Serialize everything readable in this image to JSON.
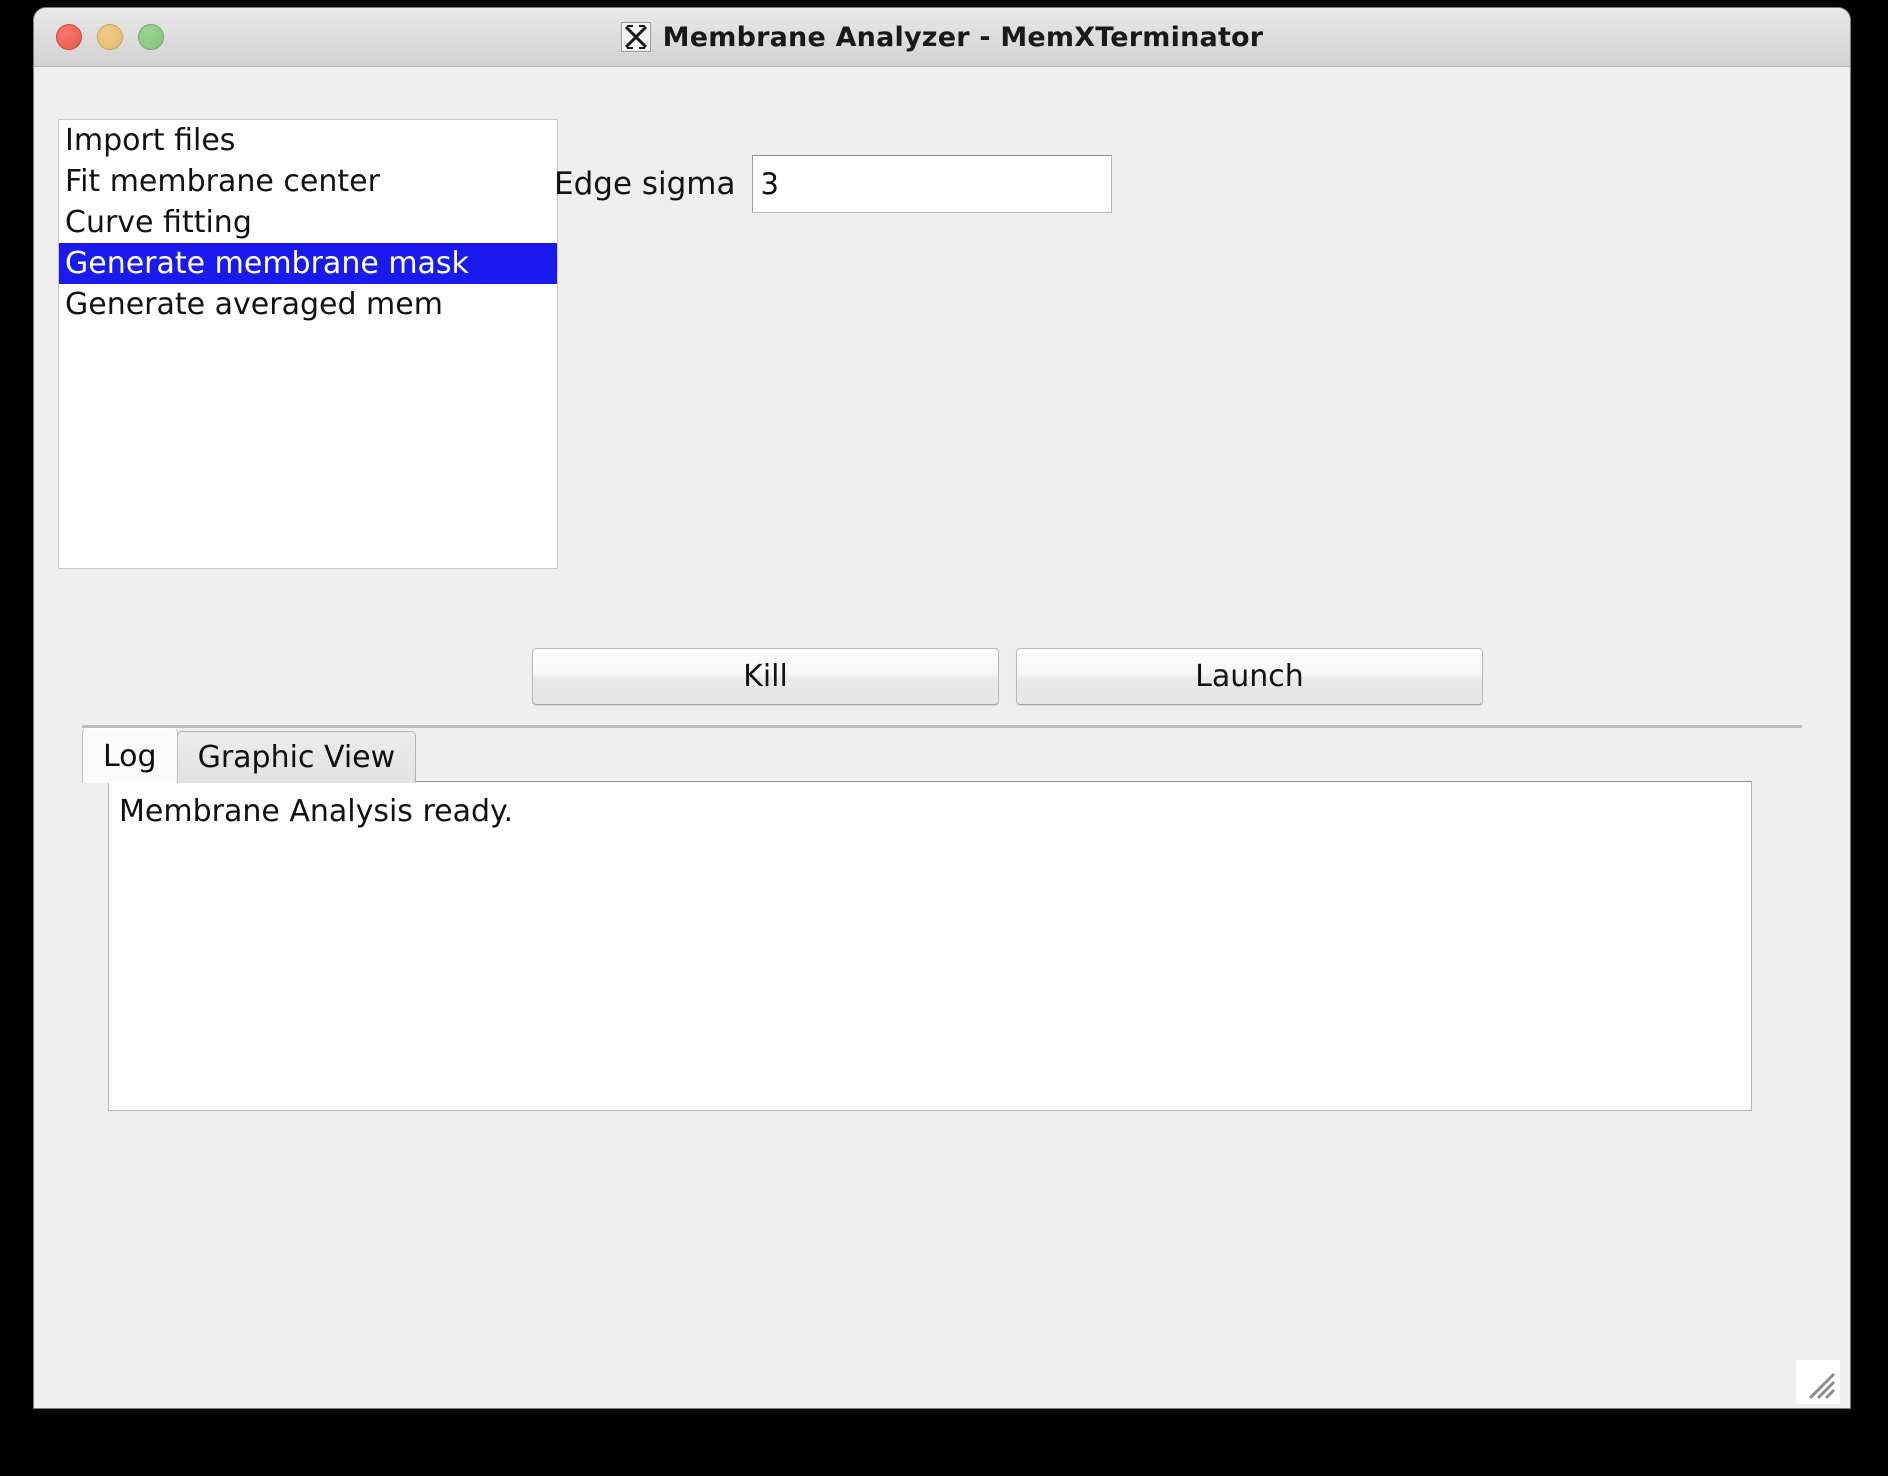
{
  "window": {
    "title": "Membrane Analyzer - MemXTerminator",
    "app_icon": "x-application-icon",
    "controls": {
      "close": "close-button",
      "minimize": "minimize-button",
      "maximize": "maximize-button"
    },
    "colors": {
      "selection": "#1a1aee",
      "selection_text": "#ffffff",
      "chrome": "#efefef",
      "close_dot": "#e8564a",
      "min_dot": "#e0bb6c",
      "max_dot": "#83c379"
    }
  },
  "task_list": {
    "selected_index": 3,
    "items": [
      {
        "label": "Import files"
      },
      {
        "label": "Fit membrane center"
      },
      {
        "label": "Curve fitting"
      },
      {
        "label": "Generate membrane mask"
      },
      {
        "label": "Generate averaged mem"
      }
    ]
  },
  "parameters": {
    "edge_sigma": {
      "label": "Edge sigma",
      "value": "3",
      "placeholder": ""
    }
  },
  "actions": {
    "kill_label": "Kill",
    "launch_label": "Launch"
  },
  "tabs": {
    "active": "Log",
    "items": [
      {
        "label": "Log"
      },
      {
        "label": "Graphic View"
      }
    ]
  },
  "log": {
    "lines": [
      "Membrane Analysis ready."
    ],
    "text": "Membrane Analysis ready."
  }
}
